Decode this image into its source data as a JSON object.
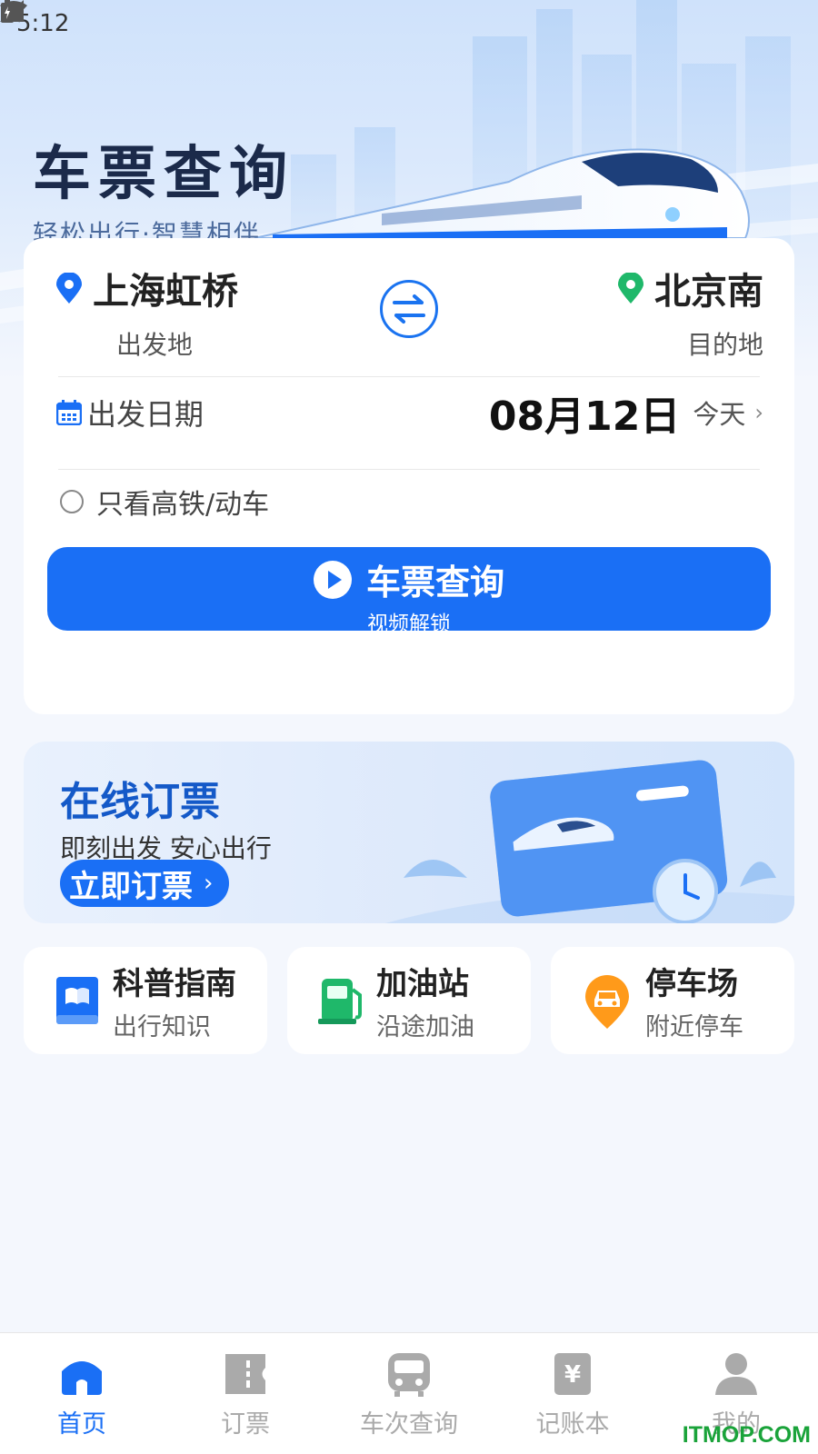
{
  "status_bar": {
    "time": "5:12"
  },
  "hero": {
    "title": "车票查询",
    "subtitle": "轻松出行·智慧相伴"
  },
  "search": {
    "from_station": "上海虹桥",
    "from_label": "出发地",
    "to_station": "北京南",
    "to_label": "目的地",
    "date_label": "出发日期",
    "date_value": "08月12日",
    "date_hint": "今天",
    "filter_label": "只看高铁/动车",
    "button_label": "车票查询",
    "button_sublabel": "视频解锁"
  },
  "booking_banner": {
    "title": "在线订票",
    "subtitle": "即刻出发 安心出行",
    "button_label": "立即订票"
  },
  "features": [
    {
      "title": "科普指南",
      "subtitle": "出行知识",
      "icon": "book-icon",
      "color": "#1a6ff5"
    },
    {
      "title": "加油站",
      "subtitle": "沿途加油",
      "icon": "gas-pump-icon",
      "color": "#1fb86a"
    },
    {
      "title": "停车场",
      "subtitle": "附近停车",
      "icon": "car-pin-icon",
      "color": "#ff9a1a"
    }
  ],
  "bottom_nav": [
    {
      "label": "首页",
      "active": true
    },
    {
      "label": "订票",
      "active": false
    },
    {
      "label": "车次查询",
      "active": false
    },
    {
      "label": "记账本",
      "active": false
    },
    {
      "label": "我的",
      "active": false
    }
  ],
  "watermark": "ITMOP.COM",
  "colors": {
    "primary": "#1a6ff5",
    "hero_title": "#1b2a4a",
    "inactive": "#aaaaaa"
  }
}
